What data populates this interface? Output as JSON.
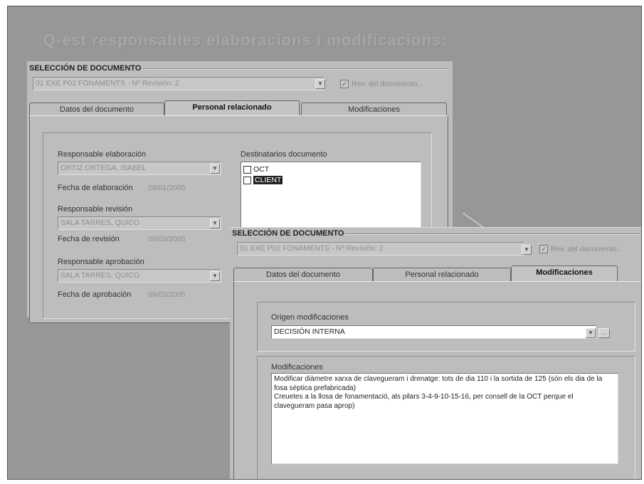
{
  "title": "Q-est responsables elaboracions i modificacions:",
  "window1": {
    "group_label": "SELECCIÓN DE DOCUMENTO",
    "document_select": "01 EXE P02 FONAMENTS - Nº Revisión: 2",
    "rev_checkbox_label": "Rev. del documento...",
    "tabs": [
      "Datos del documento",
      "Personal relacionado",
      "Modificaciones"
    ],
    "responsable_elaboracion_label": "Responsable elaboración",
    "responsable_elaboracion_value": "ORTIZ ORTEGA, ISABEL",
    "fecha_elaboracion_label": "Fecha de elaboración",
    "fecha_elaboracion_value": "28/01/2005",
    "responsable_revision_label": "Responsable revisión",
    "responsable_revision_value": "SALA TARRES, QUICO",
    "fecha_revision_label": "Fecha de revisión",
    "fecha_revision_value": "09/03/2005",
    "responsable_aprobacion_label": "Responsable aprobación",
    "responsable_aprobacion_value": "SALA TARRES, QUICO",
    "fecha_aprobacion_label": "Fecha de aprobación",
    "fecha_aprobacion_value": "09/03/2005",
    "destinatarios_label": "Destinatarios documento",
    "destinatarios": [
      "OCT",
      "CLIENT"
    ]
  },
  "window2": {
    "group_label": "SELECCIÓN DE DOCUMENTO",
    "document_select": "01 EXE P02 FONAMENTS - Nº Revisión: 2",
    "rev_checkbox_label": "Rev. del documento...",
    "tabs": [
      "Datos del documento",
      "Personal relacionado",
      "Modificaciones"
    ],
    "origen_label": "Origen modificaciones",
    "origen_value": "DECISIÓN INTERNA",
    "origen_more": "...",
    "modificaciones_label": "Modificaciones",
    "modificaciones_text": "Modificar diàmetre xarxa de clavegueram i drenatge: tots de dia 110 i la sortida de 125 (són els dia de la fosa sèptica prefabricada)\nCreuetes a la llosa de fonamentació, als pilars 3-4-9-10-15-16, per consell de la OCT perque el clavegueram pasa aprop)"
  },
  "icons": {
    "dropdown": "chevron-down-icon",
    "check": "checkmark-icon"
  },
  "colors": {
    "background": "#979797",
    "window": "#bdbdbd",
    "title": "#a6a6a6",
    "selection": "#222222"
  }
}
